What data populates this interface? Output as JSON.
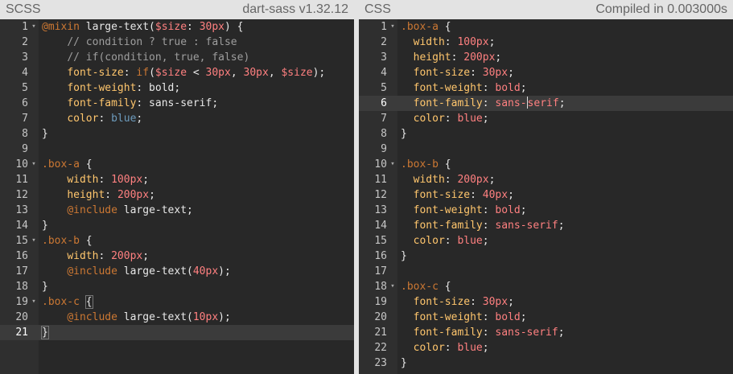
{
  "left": {
    "title": "SCSS",
    "info": "dart-sass v1.32.12",
    "lines": [
      {
        "n": "1",
        "fold": true,
        "tokens": [
          [
            "t-atr",
            "@mixin"
          ],
          [
            "t-pl",
            " large-text("
          ],
          [
            "t-num",
            "$size"
          ],
          [
            "t-pl",
            ": "
          ],
          [
            "t-num",
            "30px"
          ],
          [
            "t-pl",
            ") {"
          ]
        ]
      },
      {
        "n": "2",
        "tokens": [
          [
            "t-pl",
            "    "
          ],
          [
            "t-com",
            "// condition ? true : false"
          ]
        ]
      },
      {
        "n": "3",
        "tokens": [
          [
            "t-pl",
            "    "
          ],
          [
            "t-com",
            "// if(condition, true, false)"
          ]
        ]
      },
      {
        "n": "4",
        "tokens": [
          [
            "t-pl",
            "    "
          ],
          [
            "t-prop",
            "font-size"
          ],
          [
            "t-pl",
            ": "
          ],
          [
            "t-atr",
            "if"
          ],
          [
            "t-pl",
            "("
          ],
          [
            "t-num",
            "$size"
          ],
          [
            "t-pl",
            " < "
          ],
          [
            "t-num",
            "30px"
          ],
          [
            "t-pl",
            ", "
          ],
          [
            "t-num",
            "30px"
          ],
          [
            "t-pl",
            ", "
          ],
          [
            "t-num",
            "$size"
          ],
          [
            "t-pl",
            ");"
          ]
        ]
      },
      {
        "n": "5",
        "tokens": [
          [
            "t-pl",
            "    "
          ],
          [
            "t-prop",
            "font-weight"
          ],
          [
            "t-pl",
            ": bold;"
          ]
        ]
      },
      {
        "n": "6",
        "tokens": [
          [
            "t-pl",
            "    "
          ],
          [
            "t-prop",
            "font-family"
          ],
          [
            "t-pl",
            ": sans-serif;"
          ]
        ]
      },
      {
        "n": "7",
        "tokens": [
          [
            "t-pl",
            "    "
          ],
          [
            "t-prop",
            "color"
          ],
          [
            "t-pl",
            ": "
          ],
          [
            "t-blue",
            "blue"
          ],
          [
            "t-pl",
            ";"
          ]
        ]
      },
      {
        "n": "8",
        "tokens": [
          [
            "t-pl",
            "}"
          ]
        ]
      },
      {
        "n": "9",
        "tokens": []
      },
      {
        "n": "10",
        "fold": true,
        "tokens": [
          [
            "t-atr",
            ".box-a"
          ],
          [
            "t-pl",
            " {"
          ]
        ]
      },
      {
        "n": "11",
        "tokens": [
          [
            "t-pl",
            "    "
          ],
          [
            "t-prop",
            "width"
          ],
          [
            "t-pl",
            ": "
          ],
          [
            "t-num",
            "100px"
          ],
          [
            "t-pl",
            ";"
          ]
        ]
      },
      {
        "n": "12",
        "tokens": [
          [
            "t-pl",
            "    "
          ],
          [
            "t-prop",
            "height"
          ],
          [
            "t-pl",
            ": "
          ],
          [
            "t-num",
            "200px"
          ],
          [
            "t-pl",
            ";"
          ]
        ]
      },
      {
        "n": "13",
        "tokens": [
          [
            "t-pl",
            "    "
          ],
          [
            "t-atr",
            "@include"
          ],
          [
            "t-pl",
            " large-text;"
          ]
        ]
      },
      {
        "n": "14",
        "tokens": [
          [
            "t-pl",
            "}"
          ]
        ]
      },
      {
        "n": "15",
        "fold": true,
        "tokens": [
          [
            "t-atr",
            ".box-b"
          ],
          [
            "t-pl",
            " {"
          ]
        ]
      },
      {
        "n": "16",
        "tokens": [
          [
            "t-pl",
            "    "
          ],
          [
            "t-prop",
            "width"
          ],
          [
            "t-pl",
            ": "
          ],
          [
            "t-num",
            "200px"
          ],
          [
            "t-pl",
            ";"
          ]
        ]
      },
      {
        "n": "17",
        "tokens": [
          [
            "t-pl",
            "    "
          ],
          [
            "t-atr",
            "@include"
          ],
          [
            "t-pl",
            " large-text("
          ],
          [
            "t-num",
            "40px"
          ],
          [
            "t-pl",
            ");"
          ]
        ]
      },
      {
        "n": "18",
        "tokens": [
          [
            "t-pl",
            "}"
          ]
        ]
      },
      {
        "n": "19",
        "fold": true,
        "tokens": [
          [
            "t-atr",
            ".box-c"
          ],
          [
            "t-pl",
            " "
          ],
          [
            "bm",
            "{"
          ]
        ]
      },
      {
        "n": "20",
        "tokens": [
          [
            "t-pl",
            "    "
          ],
          [
            "t-atr",
            "@include"
          ],
          [
            "t-pl",
            " large-text("
          ],
          [
            "t-num",
            "10px"
          ],
          [
            "t-pl",
            ");"
          ]
        ]
      },
      {
        "n": "21",
        "active": true,
        "tokens": [
          [
            "bm",
            "}"
          ],
          [
            "cursor",
            ""
          ]
        ]
      }
    ]
  },
  "right": {
    "title": "CSS",
    "info": "Compiled in 0.003000s",
    "lines": [
      {
        "n": "1",
        "fold": true,
        "tokens": [
          [
            "t-atr",
            ".box-a"
          ],
          [
            "t-pl",
            " {"
          ]
        ]
      },
      {
        "n": "2",
        "tokens": [
          [
            "t-pl",
            "  "
          ],
          [
            "t-prop",
            "width"
          ],
          [
            "t-pl",
            ": "
          ],
          [
            "t-num",
            "100px"
          ],
          [
            "t-pl",
            ";"
          ]
        ]
      },
      {
        "n": "3",
        "tokens": [
          [
            "t-pl",
            "  "
          ],
          [
            "t-prop",
            "height"
          ],
          [
            "t-pl",
            ": "
          ],
          [
            "t-num",
            "200px"
          ],
          [
            "t-pl",
            ";"
          ]
        ]
      },
      {
        "n": "4",
        "tokens": [
          [
            "t-pl",
            "  "
          ],
          [
            "t-prop",
            "font-size"
          ],
          [
            "t-pl",
            ": "
          ],
          [
            "t-num",
            "30px"
          ],
          [
            "t-pl",
            ";"
          ]
        ]
      },
      {
        "n": "5",
        "tokens": [
          [
            "t-pl",
            "  "
          ],
          [
            "t-prop",
            "font-weight"
          ],
          [
            "t-pl",
            ": "
          ],
          [
            "t-num",
            "bold"
          ],
          [
            "t-pl",
            ";"
          ]
        ]
      },
      {
        "n": "6",
        "active": true,
        "tokens": [
          [
            "t-pl",
            "  "
          ],
          [
            "t-prop",
            "font-family"
          ],
          [
            "t-pl",
            ": "
          ],
          [
            "t-num",
            "sans-"
          ],
          [
            "cursor",
            ""
          ],
          [
            "t-num",
            "serif"
          ],
          [
            "t-pl",
            ";"
          ]
        ]
      },
      {
        "n": "7",
        "tokens": [
          [
            "t-pl",
            "  "
          ],
          [
            "t-prop",
            "color"
          ],
          [
            "t-pl",
            ": "
          ],
          [
            "t-num",
            "blue"
          ],
          [
            "t-pl",
            ";"
          ]
        ]
      },
      {
        "n": "8",
        "tokens": [
          [
            "t-pl",
            "}"
          ]
        ]
      },
      {
        "n": "9",
        "tokens": []
      },
      {
        "n": "10",
        "fold": true,
        "tokens": [
          [
            "t-atr",
            ".box-b"
          ],
          [
            "t-pl",
            " {"
          ]
        ]
      },
      {
        "n": "11",
        "tokens": [
          [
            "t-pl",
            "  "
          ],
          [
            "t-prop",
            "width"
          ],
          [
            "t-pl",
            ": "
          ],
          [
            "t-num",
            "200px"
          ],
          [
            "t-pl",
            ";"
          ]
        ]
      },
      {
        "n": "12",
        "tokens": [
          [
            "t-pl",
            "  "
          ],
          [
            "t-prop",
            "font-size"
          ],
          [
            "t-pl",
            ": "
          ],
          [
            "t-num",
            "40px"
          ],
          [
            "t-pl",
            ";"
          ]
        ]
      },
      {
        "n": "13",
        "tokens": [
          [
            "t-pl",
            "  "
          ],
          [
            "t-prop",
            "font-weight"
          ],
          [
            "t-pl",
            ": "
          ],
          [
            "t-num",
            "bold"
          ],
          [
            "t-pl",
            ";"
          ]
        ]
      },
      {
        "n": "14",
        "tokens": [
          [
            "t-pl",
            "  "
          ],
          [
            "t-prop",
            "font-family"
          ],
          [
            "t-pl",
            ": "
          ],
          [
            "t-num",
            "sans-serif"
          ],
          [
            "t-pl",
            ";"
          ]
        ]
      },
      {
        "n": "15",
        "tokens": [
          [
            "t-pl",
            "  "
          ],
          [
            "t-prop",
            "color"
          ],
          [
            "t-pl",
            ": "
          ],
          [
            "t-num",
            "blue"
          ],
          [
            "t-pl",
            ";"
          ]
        ]
      },
      {
        "n": "16",
        "tokens": [
          [
            "t-pl",
            "}"
          ]
        ]
      },
      {
        "n": "17",
        "tokens": []
      },
      {
        "n": "18",
        "fold": true,
        "tokens": [
          [
            "t-atr",
            ".box-c"
          ],
          [
            "t-pl",
            " {"
          ]
        ]
      },
      {
        "n": "19",
        "tokens": [
          [
            "t-pl",
            "  "
          ],
          [
            "t-prop",
            "font-size"
          ],
          [
            "t-pl",
            ": "
          ],
          [
            "t-num",
            "30px"
          ],
          [
            "t-pl",
            ";"
          ]
        ]
      },
      {
        "n": "20",
        "tokens": [
          [
            "t-pl",
            "  "
          ],
          [
            "t-prop",
            "font-weight"
          ],
          [
            "t-pl",
            ": "
          ],
          [
            "t-num",
            "bold"
          ],
          [
            "t-pl",
            ";"
          ]
        ]
      },
      {
        "n": "21",
        "tokens": [
          [
            "t-pl",
            "  "
          ],
          [
            "t-prop",
            "font-family"
          ],
          [
            "t-pl",
            ": "
          ],
          [
            "t-num",
            "sans-serif"
          ],
          [
            "t-pl",
            ";"
          ]
        ]
      },
      {
        "n": "22",
        "tokens": [
          [
            "t-pl",
            "  "
          ],
          [
            "t-prop",
            "color"
          ],
          [
            "t-pl",
            ": "
          ],
          [
            "t-num",
            "blue"
          ],
          [
            "t-pl",
            ";"
          ]
        ]
      },
      {
        "n": "23",
        "tokens": [
          [
            "t-pl",
            "}"
          ]
        ]
      }
    ]
  },
  "fold_glyph": "▾",
  "colors": {
    "header_bg": "#e3e3e3",
    "editor_bg": "#282828",
    "gutter_bg": "#2f2f2f",
    "property": "#ffc66d",
    "number": "#ff8080",
    "keyword": "#cc7833",
    "comment": "#9e9e9e",
    "value_blue": "#6d9cbe"
  }
}
